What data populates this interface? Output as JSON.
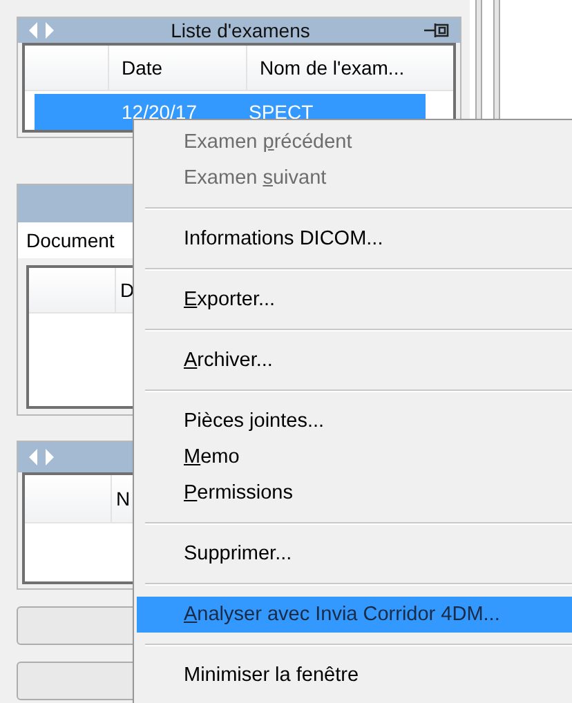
{
  "exam_list": {
    "title": "Liste d'examens",
    "columns": [
      "Date",
      "Nom de l'exam..."
    ],
    "rows": [
      {
        "date": "12/20/17",
        "name": "SPECT",
        "selected": true
      }
    ]
  },
  "documents": {
    "tab": "Document",
    "columns": [
      "D"
    ]
  },
  "panel_3": {
    "columns": [
      "N"
    ]
  },
  "context_menu": {
    "items": [
      {
        "kind": "item",
        "pre": "Examen ",
        "key": "p",
        "post": "récédent",
        "disabled": true,
        "selected": false
      },
      {
        "kind": "item",
        "pre": "Examen ",
        "key": "s",
        "post": "uivant",
        "disabled": true,
        "selected": false
      },
      {
        "kind": "separator"
      },
      {
        "kind": "item",
        "pre": "Informations DICOM...",
        "disabled": false,
        "selected": false
      },
      {
        "kind": "separator"
      },
      {
        "kind": "item",
        "key": "E",
        "post": "xporter...",
        "disabled": false,
        "selected": false
      },
      {
        "kind": "separator"
      },
      {
        "kind": "item",
        "key": "A",
        "post": "rchiver...",
        "disabled": false,
        "selected": false
      },
      {
        "kind": "separator"
      },
      {
        "kind": "item",
        "pre": "Pièces jointes...",
        "disabled": false,
        "selected": false
      },
      {
        "kind": "item",
        "key": "M",
        "post": "emo",
        "disabled": false,
        "selected": false
      },
      {
        "kind": "item",
        "key": "P",
        "post": "ermissions",
        "disabled": false,
        "selected": false
      },
      {
        "kind": "separator"
      },
      {
        "kind": "item",
        "pre": "Supprimer...",
        "disabled": false,
        "selected": false
      },
      {
        "kind": "separator"
      },
      {
        "kind": "item",
        "key": "A",
        "post": "nalyser avec Invia Corridor 4DM...",
        "disabled": false,
        "selected": true
      },
      {
        "kind": "separator"
      },
      {
        "kind": "item",
        "pre": "Minimiser la fenêtre",
        "disabled": false,
        "selected": false
      }
    ]
  }
}
